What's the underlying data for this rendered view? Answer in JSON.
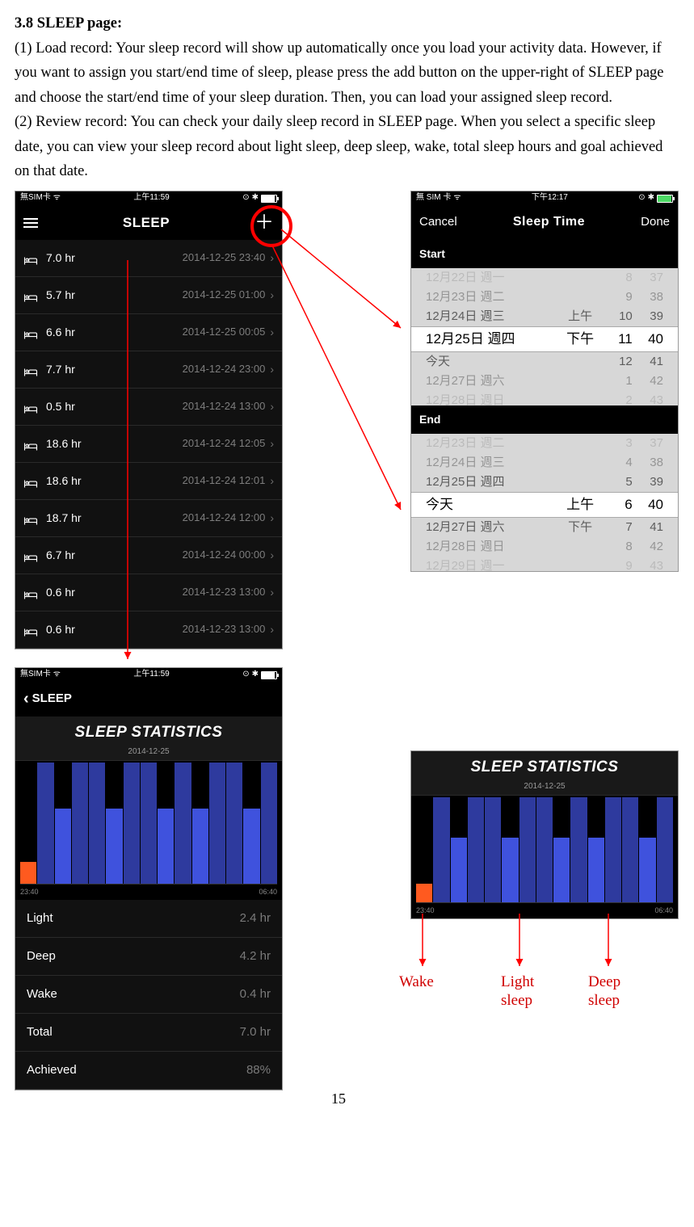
{
  "heading": "3.8 SLEEP page:",
  "para1": "(1) Load record: Your sleep record will show up automatically once you load your activity data. However, if you want to assign you start/end time of sleep, please press the add button on the upper-right of SLEEP page and choose the start/end time of your sleep duration. Then, you can load your assigned sleep record.",
  "para2": "(2) Review record: You can check your daily sleep record in SLEEP page. When you select a specific sleep date, you can view your sleep record about light sleep, deep sleep, wake, total sleep hours and goal achieved on that date.",
  "page_no": "15",
  "screen1": {
    "status_left": "無SIM卡",
    "status_time": "上午11:59",
    "nav_title": "SLEEP",
    "rows": [
      {
        "h": "7.0 hr",
        "d": "2014-12-25 23:40"
      },
      {
        "h": "5.7 hr",
        "d": "2014-12-25 01:00"
      },
      {
        "h": "6.6 hr",
        "d": "2014-12-25 00:05"
      },
      {
        "h": "7.7 hr",
        "d": "2014-12-24 23:00"
      },
      {
        "h": "0.5 hr",
        "d": "2014-12-24 13:00"
      },
      {
        "h": "18.6 hr",
        "d": "2014-12-24 12:05"
      },
      {
        "h": "18.6 hr",
        "d": "2014-12-24 12:01"
      },
      {
        "h": "18.7 hr",
        "d": "2014-12-24 12:00"
      },
      {
        "h": "6.7 hr",
        "d": "2014-12-24 00:00"
      },
      {
        "h": "0.6 hr",
        "d": "2014-12-23 13:00"
      },
      {
        "h": "0.6 hr",
        "d": "2014-12-23 13:00"
      }
    ]
  },
  "screen2": {
    "status_left": "無 SIM 卡",
    "status_time": "下午12:17",
    "cancel": "Cancel",
    "title": "Sleep Time",
    "done": "Done",
    "start_label": "Start",
    "end_label": "End",
    "start_rows": [
      {
        "d": "12月22日 週一",
        "a": "",
        "h": "8",
        "m": "37",
        "cls": "faded3"
      },
      {
        "d": "12月23日 週二",
        "a": "",
        "h": "9",
        "m": "38",
        "cls": "faded2"
      },
      {
        "d": "12月24日 週三",
        "a": "上午",
        "h": "10",
        "m": "39",
        "cls": "faded1"
      },
      {
        "d": "12月25日 週四",
        "a": "下午",
        "h": "11",
        "m": "40",
        "cls": "sel"
      },
      {
        "d": "今天",
        "a": "",
        "h": "12",
        "m": "41",
        "cls": "faded1"
      },
      {
        "d": "12月27日 週六",
        "a": "",
        "h": "1",
        "m": "42",
        "cls": "faded2"
      },
      {
        "d": "12月28日 週日",
        "a": "",
        "h": "2",
        "m": "43",
        "cls": "faded3"
      }
    ],
    "end_rows": [
      {
        "d": "12月23日 週二",
        "a": "",
        "h": "3",
        "m": "37",
        "cls": "faded3"
      },
      {
        "d": "12月24日 週三",
        "a": "",
        "h": "4",
        "m": "38",
        "cls": "faded2"
      },
      {
        "d": "12月25日 週四",
        "a": "",
        "h": "5",
        "m": "39",
        "cls": "faded1"
      },
      {
        "d": "今天",
        "a": "上午",
        "h": "6",
        "m": "40",
        "cls": "sel"
      },
      {
        "d": "12月27日 週六",
        "a": "下午",
        "h": "7",
        "m": "41",
        "cls": "faded1"
      },
      {
        "d": "12月28日 週日",
        "a": "",
        "h": "8",
        "m": "42",
        "cls": "faded2"
      },
      {
        "d": "12月29日 週一",
        "a": "",
        "h": "9",
        "m": "43",
        "cls": "faded3"
      }
    ]
  },
  "screen3": {
    "status_left": "無SIM卡",
    "status_time": "上午11:59",
    "back": "SLEEP",
    "stats_title": "SLEEP STATISTICS",
    "stats_date": "2014-12-25",
    "x_start": "23:40",
    "x_end": "06:40",
    "info": [
      {
        "k": "Light",
        "v": "2.4 hr"
      },
      {
        "k": "Deep",
        "v": "4.2 hr"
      },
      {
        "k": "Wake",
        "v": "0.4 hr"
      },
      {
        "k": "Total",
        "v": "7.0 hr"
      },
      {
        "k": "Achieved",
        "v": "88%"
      }
    ]
  },
  "screen4": {
    "stats_title": "SLEEP STATISTICS",
    "stats_date": "2014-12-25",
    "x_start": "23:40",
    "x_end": "06:40"
  },
  "annotations": {
    "wake": "Wake",
    "light": "Light\nsleep",
    "deep": "Deep\nsleep"
  },
  "chart_data": {
    "type": "bar",
    "title": "SLEEP STATISTICS",
    "subtitle": "2014-12-25",
    "xlabel": "",
    "ylabel": "",
    "x_range": [
      "23:40",
      "06:40"
    ],
    "series": [
      {
        "name": "state",
        "values": [
          "wake",
          "deep",
          "light",
          "deep",
          "deep",
          "light",
          "deep",
          "deep",
          "light",
          "deep",
          "light",
          "deep",
          "deep",
          "light",
          "deep"
        ]
      }
    ],
    "heights_pct": [
      18,
      100,
      62,
      100,
      100,
      62,
      100,
      100,
      62,
      100,
      62,
      100,
      100,
      62,
      100
    ],
    "legend": {
      "wake": "#ff5a1f",
      "light": "#3f52dd",
      "deep": "#2e3a9e"
    },
    "summary": {
      "Light": "2.4 hr",
      "Deep": "4.2 hr",
      "Wake": "0.4 hr",
      "Total": "7.0 hr",
      "Achieved": "88%"
    }
  }
}
